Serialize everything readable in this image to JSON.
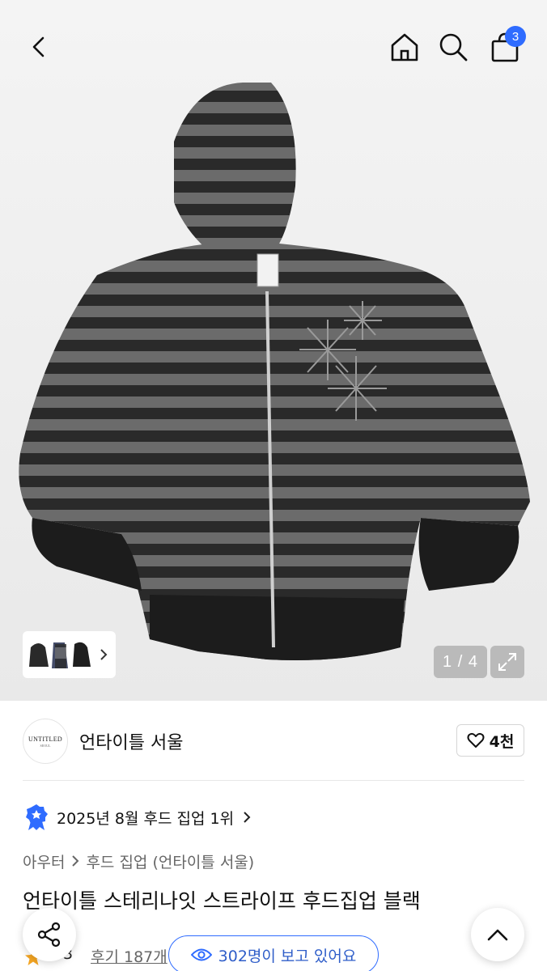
{
  "header": {
    "back_icon": "chevron-left-icon",
    "home_icon": "home-icon",
    "search_icon": "search-icon",
    "cart_icon": "shopping-bag-icon",
    "cart_count": "3",
    "badge_color": "#2f6cff"
  },
  "gallery": {
    "page_indicator": "1 / 4",
    "expand_icon": "expand-icon",
    "thumbnail_more_icon": "chevron-right-icon"
  },
  "brand": {
    "logo_line1": "UNTITLED",
    "logo_line2": "SEOUL",
    "name": "언타이틀 서울",
    "like_icon": "heart-icon",
    "like_count": "4천"
  },
  "ranking": {
    "badge_icon": "rank-badge-icon",
    "text": "2025년 8월 후드 집업 1위"
  },
  "breadcrumb": {
    "items": [
      "아우터",
      "후드 집업 (언타이틀 서울)"
    ]
  },
  "product": {
    "title": "언타이틀 스테리나잇 스트라이프 후드집업 블랙"
  },
  "bottom": {
    "rating_partial": "3",
    "reviews_label": "후기 187개",
    "viewers_label": "302명이 보고 있어요",
    "accent_color": "#2f6cff"
  }
}
